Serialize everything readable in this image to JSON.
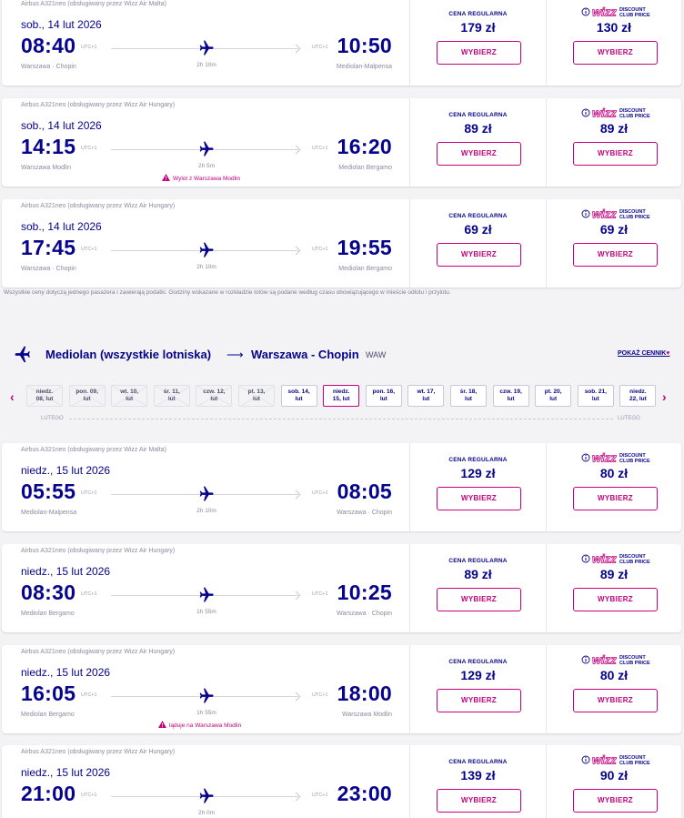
{
  "outbound_flights": [
    {
      "aircraft": "Airbus A321neo (obsługiwany przez Wizz Air Malta)",
      "date": "sob., 14 lut 2026",
      "dep_time": "08:40",
      "arr_time": "10:50",
      "dep_utc": "UTC+1",
      "arr_utc": "UTC+1",
      "dep_airport": "Warszawa · Chopin",
      "arr_airport": "Mediolan-Malpensa",
      "duration": "2h 10m",
      "note": "",
      "regular_label": "CENA REGULARNA",
      "regular_price": "179 zł",
      "wdc_price": "130 zł",
      "select_label": "WYBIERZ"
    },
    {
      "aircraft": "Airbus A321neo (obsługiwany przez Wizz Air Hungary)",
      "date": "sob., 14 lut 2026",
      "dep_time": "14:15",
      "arr_time": "16:20",
      "dep_utc": "UTC+1",
      "arr_utc": "UTC+1",
      "dep_airport": "Warszawa Modlin",
      "arr_airport": "Mediolan Bergamo",
      "duration": "2h 5m",
      "note": "Wylot z Warszawa Modlin",
      "regular_label": "CENA REGULARNA",
      "regular_price": "89 zł",
      "wdc_price": "89 zł",
      "select_label": "WYBIERZ"
    },
    {
      "aircraft": "Airbus A321neo (obsługiwany przez Wizz Air Hungary)",
      "date": "sob., 14 lut 2026",
      "dep_time": "17:45",
      "arr_time": "19:55",
      "dep_utc": "UTC+1",
      "arr_utc": "UTC+1",
      "dep_airport": "Warszawa · Chopin",
      "arr_airport": "Mediolan Bergamo",
      "duration": "2h 10m",
      "note": "",
      "regular_label": "CENA REGULARNA",
      "regular_price": "69 zł",
      "wdc_price": "69 zł",
      "select_label": "WYBIERZ"
    }
  ],
  "disclaimer": "Wszystkie ceny dotyczą jednego pasażera i zawierają podatki. Godziny wskazane w rozkładzie lotów są podane według czasu obowiązującego w mieście odlotu i przylotu.",
  "return_route": {
    "from": "Mediolan (wszystkie lotniska)",
    "arrow": "⟶",
    "to": "Warszawa - Chopin",
    "code": "WAW",
    "show_prices": "POKAŻ CENNIK",
    "heart": "♥"
  },
  "date_strip": {
    "prev": "‹",
    "next": "›",
    "month_left": "LUTEGO",
    "month_right": "LUTEGO",
    "dates": [
      {
        "l1": "niedz.",
        "l2": "08, lut",
        "state": "disabled"
      },
      {
        "l1": "pon. 09,",
        "l2": "lut",
        "state": "disabled"
      },
      {
        "l1": "wt. 10,",
        "l2": "lut",
        "state": "disabled"
      },
      {
        "l1": "śr. 11,",
        "l2": "lut",
        "state": "disabled"
      },
      {
        "l1": "czw. 12,",
        "l2": "lut",
        "state": "disabled"
      },
      {
        "l1": "pt. 13,",
        "l2": "lut",
        "state": "disabled"
      },
      {
        "l1": "sob. 14,",
        "l2": "lut",
        "state": "normal"
      },
      {
        "l1": "niedz.",
        "l2": "15, lut",
        "state": "selected"
      },
      {
        "l1": "pon. 16,",
        "l2": "lut",
        "state": "normal"
      },
      {
        "l1": "wt. 17,",
        "l2": "lut",
        "state": "normal"
      },
      {
        "l1": "śr. 18,",
        "l2": "lut",
        "state": "normal"
      },
      {
        "l1": "czw. 19,",
        "l2": "lut",
        "state": "normal"
      },
      {
        "l1": "pt. 20,",
        "l2": "lut",
        "state": "normal"
      },
      {
        "l1": "sob. 21,",
        "l2": "lut",
        "state": "normal"
      },
      {
        "l1": "niedz.",
        "l2": "22, lut",
        "state": "normal"
      }
    ]
  },
  "return_flights": [
    {
      "aircraft": "Airbus A321neo (obsługiwany przez Wizz Air Malta)",
      "date": "niedz., 15 lut 2026",
      "dep_time": "05:55",
      "arr_time": "08:05",
      "dep_utc": "UTC+1",
      "arr_utc": "UTC+1",
      "dep_airport": "Mediolan-Malpensa",
      "arr_airport": "Warszawa · Chopin",
      "duration": "2h 10m",
      "note": "",
      "regular_label": "CENA REGULARNA",
      "regular_price": "129 zł",
      "wdc_price": "80 zł",
      "select_label": "WYBIERZ"
    },
    {
      "aircraft": "Airbus A321neo (obsługiwany przez Wizz Air Hungary)",
      "date": "niedz., 15 lut 2026",
      "dep_time": "08:30",
      "arr_time": "10:25",
      "dep_utc": "UTC+1",
      "arr_utc": "UTC+1",
      "dep_airport": "Mediolan Bergamo",
      "arr_airport": "Warszawa · Chopin",
      "duration": "1h 55m",
      "note": "",
      "regular_label": "CENA REGULARNA",
      "regular_price": "89 zł",
      "wdc_price": "89 zł",
      "select_label": "WYBIERZ"
    },
    {
      "aircraft": "Airbus A321neo (obsługiwany przez Wizz Air Hungary)",
      "date": "niedz., 15 lut 2026",
      "dep_time": "16:05",
      "arr_time": "18:00",
      "dep_utc": "UTC+1",
      "arr_utc": "UTC+1",
      "dep_airport": "Mediolan Bergamo",
      "arr_airport": "Warszawa Modlin",
      "duration": "1h 55m",
      "note": "ląduje na Warszawa Modlin",
      "regular_label": "CENA REGULARNA",
      "regular_price": "129 zł",
      "wdc_price": "80 zł",
      "select_label": "WYBIERZ"
    },
    {
      "aircraft": "Airbus A321neo (obsługiwany przez Wizz Air Hungary)",
      "date": "niedz., 15 lut 2026",
      "dep_time": "21:00",
      "arr_time": "23:00",
      "dep_utc": "UTC+1",
      "arr_utc": "UTC+1",
      "dep_airport": "",
      "arr_airport": "",
      "duration": "2h 0m",
      "note": "",
      "regular_label": "CENA REGULARNA",
      "regular_price": "139 zł",
      "wdc_price": "90 zł",
      "select_label": "WYBIERZ"
    }
  ],
  "wdc_logo": {
    "brand": "wizz",
    "line1": "DISCOUNT",
    "line2": "CLUB PRICE"
  },
  "colors": {
    "primary": "#06038d",
    "accent": "#c6007e",
    "background": "#f3f3f6"
  },
  "icons": {
    "plane": "plane-icon",
    "warning": "warning-icon",
    "info": "info-icon"
  }
}
